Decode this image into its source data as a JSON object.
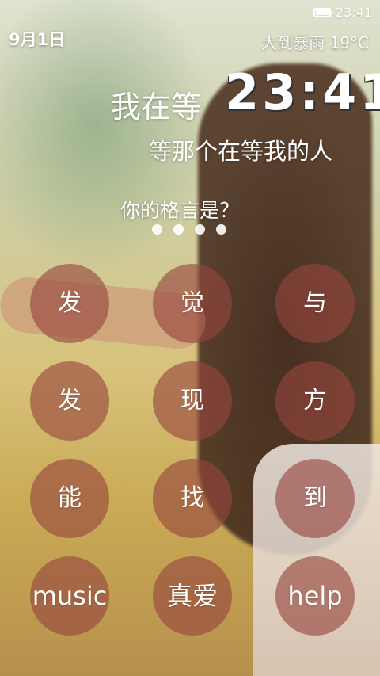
{
  "status_bar": {
    "time": "23:41",
    "battery_icon": "battery-full-icon"
  },
  "lock_screen": {
    "date": "9月1日",
    "weather": "大到暴雨  19°C",
    "clock": "23:41",
    "slogan_line1": "我在等",
    "slogan_line2": "等那个在等我的人",
    "question": "你的格言是？",
    "passcode_dots_filled": 4
  },
  "keypad": {
    "keys": [
      "发",
      "觉",
      "与",
      "发",
      "现",
      "方",
      "能",
      "找",
      "到",
      "music",
      "真爱",
      "help"
    ]
  },
  "colors": {
    "key_bg": "#96463e",
    "text": "#ffffff"
  }
}
